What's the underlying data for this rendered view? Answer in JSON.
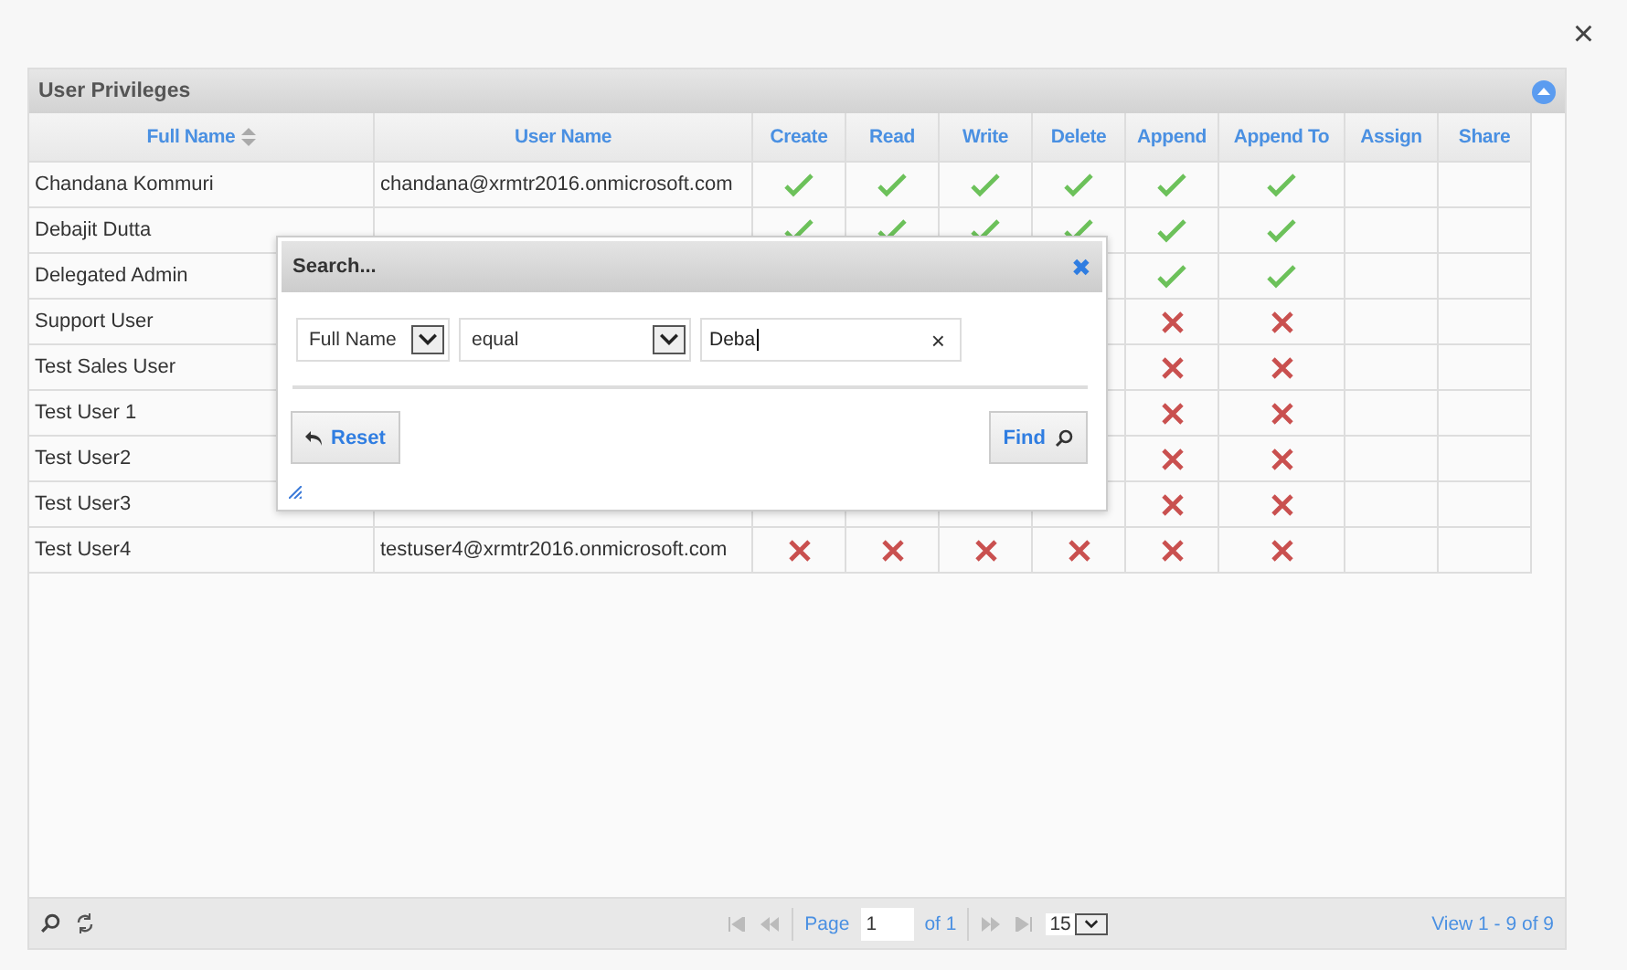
{
  "close_label": "×",
  "panel": {
    "title": "User Privileges",
    "collapsed": false
  },
  "columns": [
    {
      "label": "Full Name",
      "sorted": true
    },
    {
      "label": "User Name",
      "sorted": false
    },
    {
      "label": "Create",
      "sorted": false
    },
    {
      "label": "Read",
      "sorted": false
    },
    {
      "label": "Write",
      "sorted": false
    },
    {
      "label": "Delete",
      "sorted": false
    },
    {
      "label": "Append",
      "sorted": false
    },
    {
      "label": "Append To",
      "sorted": false
    },
    {
      "label": "Assign",
      "sorted": false
    },
    {
      "label": "Share",
      "sorted": false
    }
  ],
  "rows": [
    {
      "full_name": "Chandana Kommuri",
      "user_name": "chandana@xrmtr2016.onmicrosoft.com",
      "create": true,
      "read": true,
      "write": true,
      "delete": true,
      "append": true,
      "append_to": true
    },
    {
      "full_name": "Debajit Dutta",
      "create": true,
      "read": true,
      "write": true,
      "delete": true,
      "append": true,
      "append_to": true
    },
    {
      "full_name": "Delegated Admin",
      "append": true,
      "append_to": true
    },
    {
      "full_name": "Support User",
      "append": false,
      "append_to": false
    },
    {
      "full_name": "Test Sales User",
      "append": false,
      "append_to": false
    },
    {
      "full_name": "Test User 1",
      "append": false,
      "append_to": false
    },
    {
      "full_name": "Test User2",
      "append": false,
      "append_to": false
    },
    {
      "full_name": "Test User3",
      "append": false,
      "append_to": false
    },
    {
      "full_name": "Test User4",
      "user_name": "testuser4@xrmtr2016.onmicrosoft.com",
      "create": false,
      "read": false,
      "write": false,
      "delete": false,
      "append": false,
      "append_to": false
    }
  ],
  "search_dialog": {
    "title": "Search...",
    "close_label": "✖",
    "field": "Full Name",
    "operator": "equal",
    "value": "Deba",
    "clear_label": "×",
    "reset_label": "Reset",
    "find_label": "Find"
  },
  "pager": {
    "page_label": "Page",
    "page": "1",
    "of_label": "of 1",
    "page_size": "15",
    "summary": "View 1 - 9 of 9"
  }
}
